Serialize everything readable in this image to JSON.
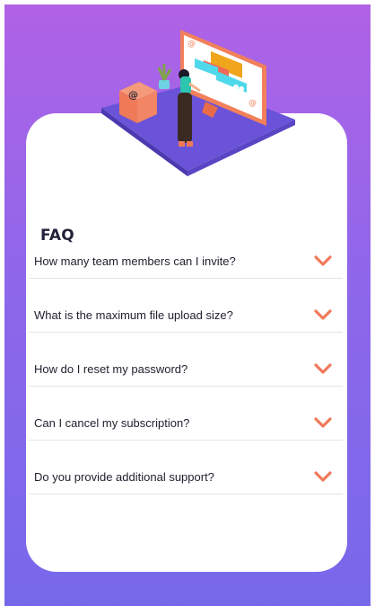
{
  "faq": {
    "title": "FAQ",
    "items": [
      {
        "question": "How many team members can I invite?",
        "expanded": false
      },
      {
        "question": "What is the maximum file upload size?",
        "expanded": false
      },
      {
        "question": "How do I reset my password?",
        "expanded": false
      },
      {
        "question": "Can I cancel my subscription?",
        "expanded": false
      },
      {
        "question": "Do you provide additional support?",
        "expanded": false
      }
    ]
  },
  "icons": {
    "chevron": "chevron-down-icon",
    "hero": "person-at-computer-illustration"
  },
  "colors": {
    "gradient_top": "#b062e6",
    "gradient_bottom": "#7768ea",
    "accent": "#f07a5a",
    "text": "#1f1f2e"
  }
}
